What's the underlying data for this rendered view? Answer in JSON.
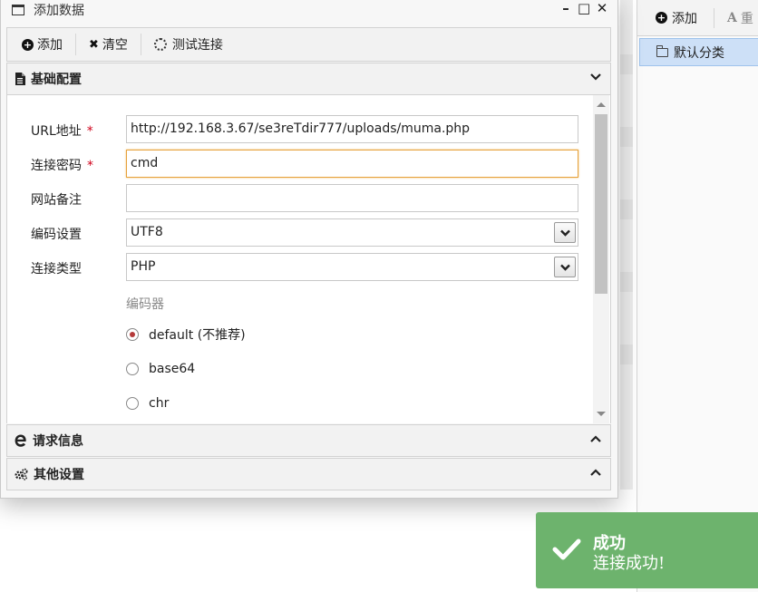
{
  "dialog": {
    "title": "添加数据",
    "controls": {
      "minimize": "–",
      "maximize": "□",
      "close": "✕"
    }
  },
  "toolbar": {
    "add_label": "添加",
    "clear_label": "清空",
    "test_label": "测试连接"
  },
  "sections": {
    "basic": "基础配置",
    "request": "请求信息",
    "other": "其他设置"
  },
  "form": {
    "url_label": "URL地址",
    "url_value": "http://192.168.3.67/se3reTdir777/uploads/muma.php",
    "password_label": "连接密码",
    "password_value": "cmd",
    "note_label": "网站备注",
    "note_value": "",
    "encoding_label": "编码设置",
    "encoding_value": "UTF8",
    "type_label": "连接类型",
    "type_value": "PHP",
    "required_mark": "*",
    "encoder_title": "编码器",
    "encoders": [
      {
        "label": "default (不推荐)",
        "checked": true
      },
      {
        "label": "base64",
        "checked": false
      },
      {
        "label": "chr",
        "checked": false
      }
    ]
  },
  "right_panel": {
    "add_label": "添加",
    "rename_glyph": "A",
    "rename_label": "重",
    "category": "默认分类"
  },
  "toast": {
    "title": "成功",
    "message": "连接成功!",
    "color": "#6db36d"
  }
}
